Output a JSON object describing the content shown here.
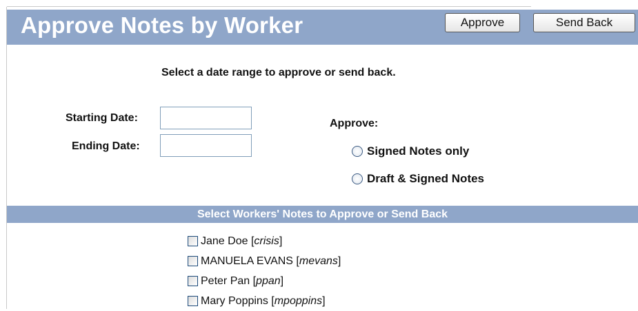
{
  "header": {
    "title": "Approve Notes by Worker",
    "approve_label": "Approve",
    "send_back_label": "Send Back"
  },
  "instruction": "Select a date range to approve or send back.",
  "date_range": {
    "start_label": "Starting Date:",
    "start_value": "",
    "end_label": "Ending Date:",
    "end_value": ""
  },
  "approve_options": {
    "label": "Approve:",
    "options": [
      {
        "label": "Signed Notes only",
        "selected": false
      },
      {
        "label": "Draft & Signed Notes",
        "selected": false
      }
    ]
  },
  "workers_section": {
    "title": "Select Workers' Notes to Approve or Send Back",
    "workers": [
      {
        "name": "Jane Doe",
        "username": "crisis",
        "checked": false
      },
      {
        "name": "MANUELA EVANS",
        "username": "mevans",
        "checked": false
      },
      {
        "name": "Peter Pan",
        "username": "ppan",
        "checked": false
      },
      {
        "name": "Mary Poppins",
        "username": "mpoppins",
        "checked": false
      }
    ]
  },
  "colors": {
    "header_bg": "#8fa6c9",
    "header_text": "#ffffff"
  }
}
